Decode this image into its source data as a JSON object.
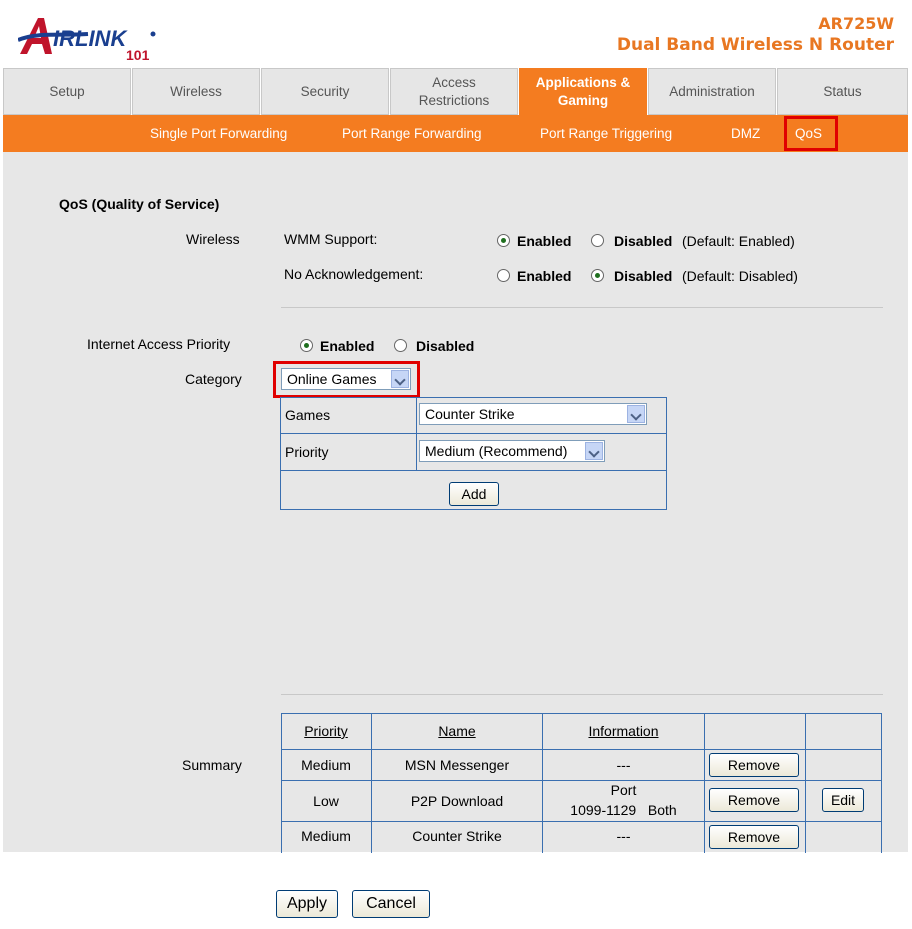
{
  "brand": {
    "logo_text": "IRLINK",
    "logo_num": "101",
    "model": "AR725W",
    "product": "Dual Band Wireless N Router"
  },
  "tabs": [
    {
      "label": "Setup"
    },
    {
      "label": "Wireless"
    },
    {
      "label": "Security"
    },
    {
      "label": "Access Restrictions"
    },
    {
      "label": "Applications & Gaming"
    },
    {
      "label": "Administration"
    },
    {
      "label": "Status"
    }
  ],
  "subnav": [
    {
      "label": "Single Port Forwarding"
    },
    {
      "label": "Port Range Forwarding"
    },
    {
      "label": "Port Range Triggering"
    },
    {
      "label": "DMZ"
    },
    {
      "label": "QoS"
    }
  ],
  "section_title": "QoS (Quality of Service)",
  "wireless": {
    "label": "Wireless",
    "wmm_label": "WMM Support:",
    "wmm_default": "(Default: Enabled)",
    "noack_label": "No Acknowledgement:",
    "noack_default": "(Default: Disabled)",
    "enabled": "Enabled",
    "disabled": "Disabled"
  },
  "internet": {
    "label": "Internet Access Priority",
    "enabled": "Enabled",
    "disabled": "Disabled"
  },
  "category": {
    "label": "Category",
    "value": "Online Games"
  },
  "games_table": {
    "games_label": "Games",
    "games_value": "Counter Strike",
    "priority_label": "Priority",
    "priority_value": "Medium (Recommend)",
    "add_label": "Add"
  },
  "summary": {
    "label": "Summary",
    "headers": {
      "priority": "Priority",
      "name": "Name",
      "information": "Information"
    },
    "rows": [
      {
        "priority": "Medium",
        "name": "MSN Messenger",
        "info": "---",
        "remove": "Remove",
        "edit": ""
      },
      {
        "priority": "Low",
        "name": "P2P Download",
        "info1": "Port",
        "info2": "1099-1129   Both",
        "remove": "Remove",
        "edit": "Edit"
      },
      {
        "priority": "Medium",
        "name": "Counter Strike",
        "info": "---",
        "remove": "Remove",
        "edit": ""
      }
    ]
  },
  "footer": {
    "apply": "Apply",
    "cancel": "Cancel"
  },
  "colors": {
    "accent": "#f47c20",
    "highlight": "#e00000",
    "table_border": "#3a6fb0"
  }
}
